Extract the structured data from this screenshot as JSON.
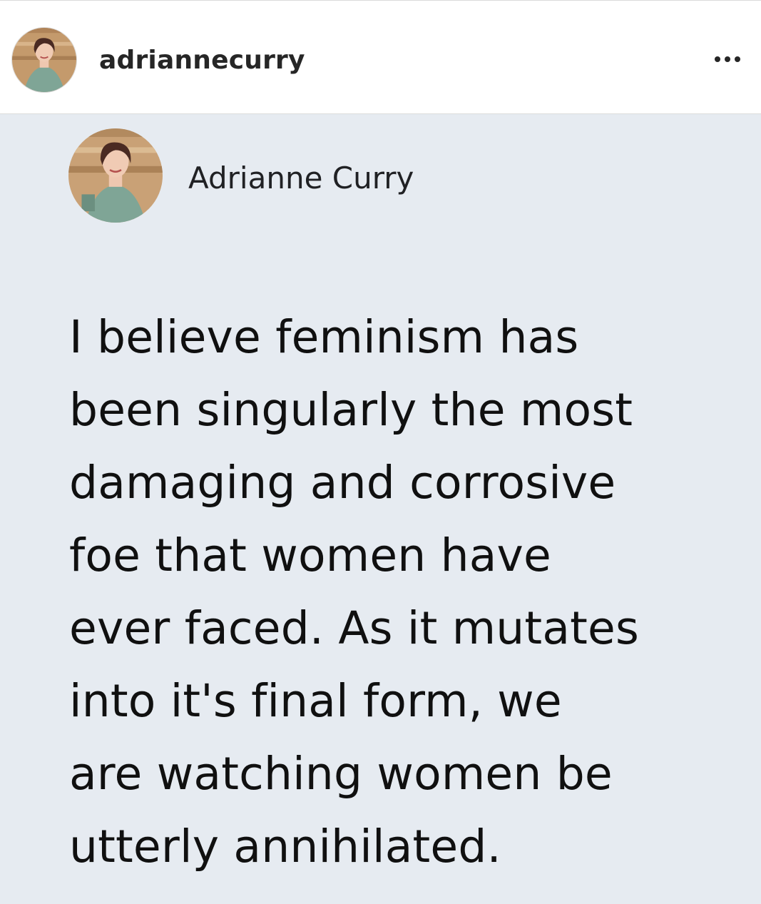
{
  "header": {
    "username": "adriannecurry",
    "avatar_icon": "profile-photo",
    "more_icon": "more-horizontal-icon"
  },
  "post": {
    "author_name": "Adrianne Curry",
    "avatar_icon": "profile-photo",
    "text": "I believe feminism has\nbeen singularly the most\ndamaging and corrosive\nfoe that women have\never faced. As it mutates\ninto it's final form, we\nare watching women be\nutterly annihilated."
  },
  "colors": {
    "header_background": "#ffffff",
    "post_background": "#e6ebf1",
    "text": "#101010"
  }
}
